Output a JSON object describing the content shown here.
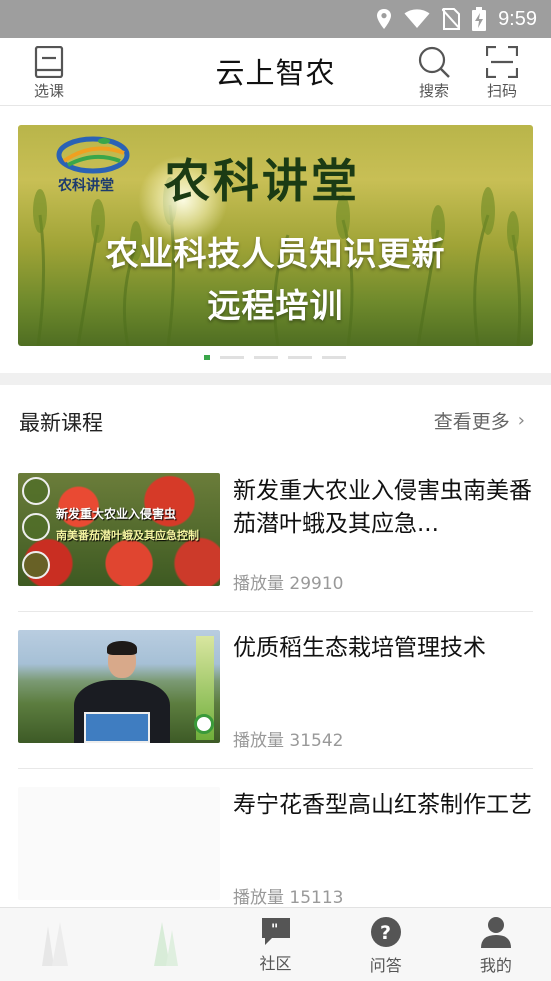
{
  "status_bar": {
    "time": "9:59",
    "icons": [
      "location-icon",
      "wifi-icon",
      "no-sim-icon",
      "battery-charging-icon"
    ]
  },
  "top_nav": {
    "left_button": {
      "label": "选课",
      "icon": "book-icon"
    },
    "title": "云上智农",
    "search_button": {
      "label": "搜索",
      "icon": "search-icon"
    },
    "scan_button": {
      "label": "扫码",
      "icon": "scan-icon"
    }
  },
  "banner": {
    "logo_text": "农科讲堂",
    "title": "农科讲堂",
    "line1": "农业科技人员知识更新",
    "line2": "远程培训",
    "dots_count": 5,
    "active_dot": 0
  },
  "latest_courses": {
    "title": "最新课程",
    "more_label": "查看更多",
    "items": [
      {
        "title": "新发重大农业入侵害虫南美番茄潜叶蛾及其应急...",
        "plays_label": "播放量 29910",
        "thumb_text_1": "新发重大农业入侵害虫",
        "thumb_text_2": "南美番茄潜叶蛾及其应急控制"
      },
      {
        "title": "优质稻生态栽培管理技术",
        "plays_label": "播放量 31542"
      },
      {
        "title": "寿宁花香型高山红茶制作工艺",
        "plays_label": "播放量 15113"
      }
    ]
  },
  "tab_bar": {
    "tabs": [
      {
        "label": "",
        "icon": "home-icon",
        "active": false
      },
      {
        "label": "",
        "icon": "study-icon",
        "active": false
      },
      {
        "label": "社区",
        "icon": "community-icon",
        "active": false
      },
      {
        "label": "问答",
        "icon": "question-icon",
        "active": false
      },
      {
        "label": "我的",
        "icon": "profile-icon",
        "active": false
      }
    ]
  },
  "colors": {
    "accent_green": "#3aa64a",
    "status_bar": "#9e9e9e",
    "text_primary": "#111111",
    "text_secondary": "#999999"
  }
}
